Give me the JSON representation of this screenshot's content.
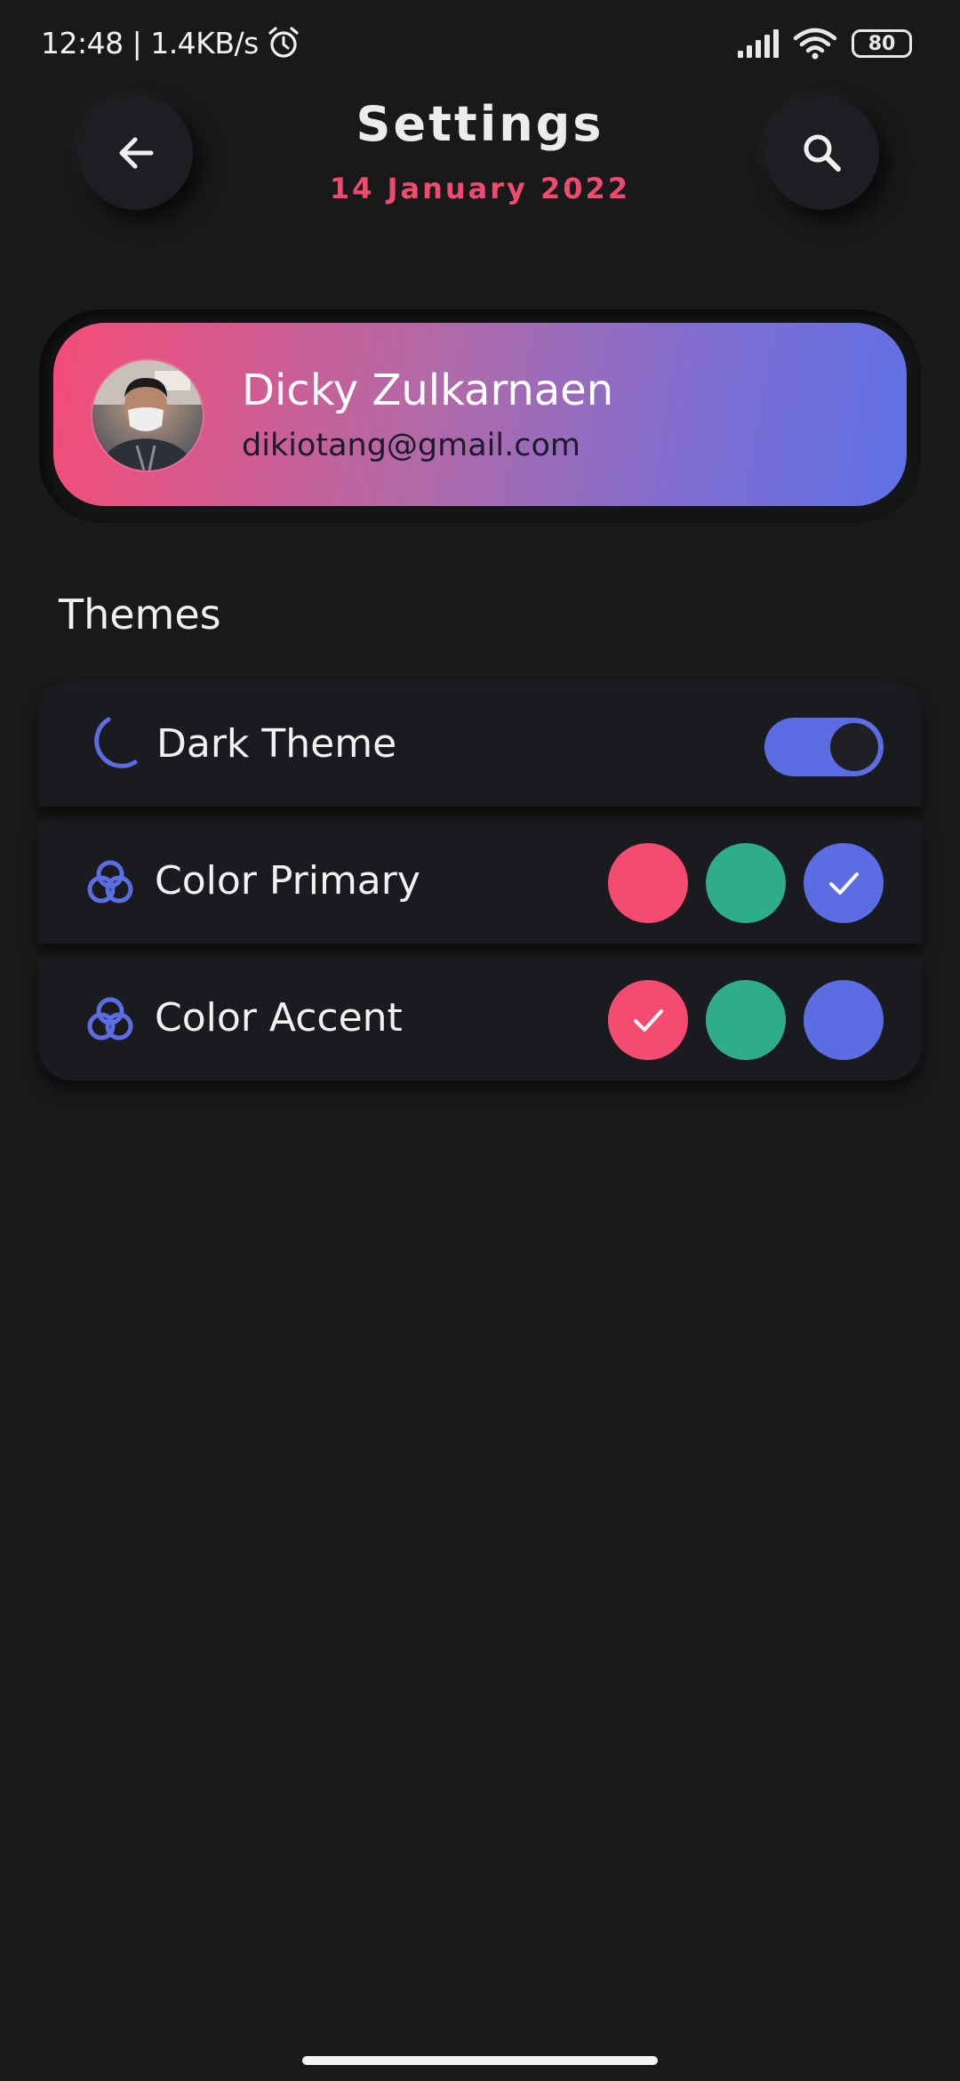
{
  "status_bar": {
    "time_speed": "12:48 | 1.4KB/s",
    "battery": "80",
    "icons": [
      "alarm-icon",
      "signal-icon",
      "wifi-icon",
      "battery-icon"
    ]
  },
  "header": {
    "title": "Settings",
    "date": "14 January 2022",
    "back_icon": "arrow-left-icon",
    "search_icon": "search-icon"
  },
  "profile": {
    "name": "Dicky Zulkarnaen",
    "email": "dikiotang@gmail.com",
    "gradient_start": "#f54c77",
    "gradient_end": "#5f71e6"
  },
  "themes": {
    "section_title": "Themes",
    "dark_theme": {
      "label": "Dark Theme",
      "icon": "moon-icon",
      "enabled": true
    },
    "color_primary": {
      "label": "Color Primary",
      "icon": "color-circles-icon",
      "options": [
        {
          "color": "#f64b71",
          "selected": false
        },
        {
          "color": "#2fac88",
          "selected": false
        },
        {
          "color": "#5c6ce2",
          "selected": true
        }
      ]
    },
    "color_accent": {
      "label": "Color Accent",
      "icon": "color-circles-icon",
      "options": [
        {
          "color": "#f64b71",
          "selected": true
        },
        {
          "color": "#2fac88",
          "selected": false
        },
        {
          "color": "#5c6ce2",
          "selected": false
        }
      ]
    }
  },
  "colors": {
    "background": "#18191b",
    "accent_pink": "#ef4b6e",
    "accent_blue": "#5c6ce2",
    "accent_green": "#2fac88"
  }
}
